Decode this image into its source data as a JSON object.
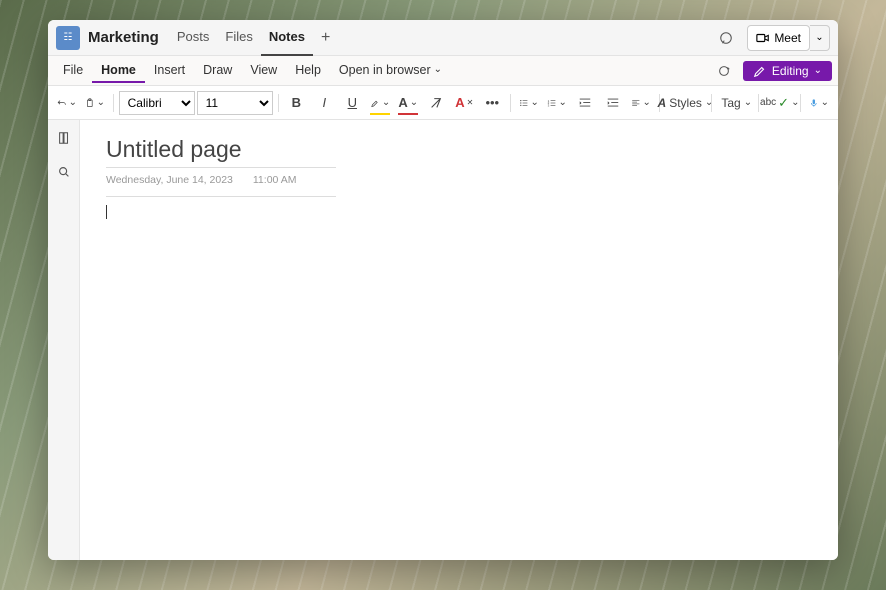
{
  "header": {
    "team_name": "Marketing",
    "tabs": [
      "Posts",
      "Files",
      "Notes"
    ],
    "active_tab": 2,
    "meet_label": "Meet"
  },
  "menubar": {
    "items": [
      "File",
      "Home",
      "Insert",
      "Draw",
      "View",
      "Help",
      "Open in browser"
    ],
    "active": 1,
    "editing_label": "Editing"
  },
  "toolbar": {
    "font_name": "Calibri",
    "font_size": "11",
    "styles_label": "Styles",
    "tag_label": "Tag"
  },
  "page": {
    "title": "Untitled page",
    "date": "Wednesday, June 14, 2023",
    "time": "11:00 AM"
  }
}
